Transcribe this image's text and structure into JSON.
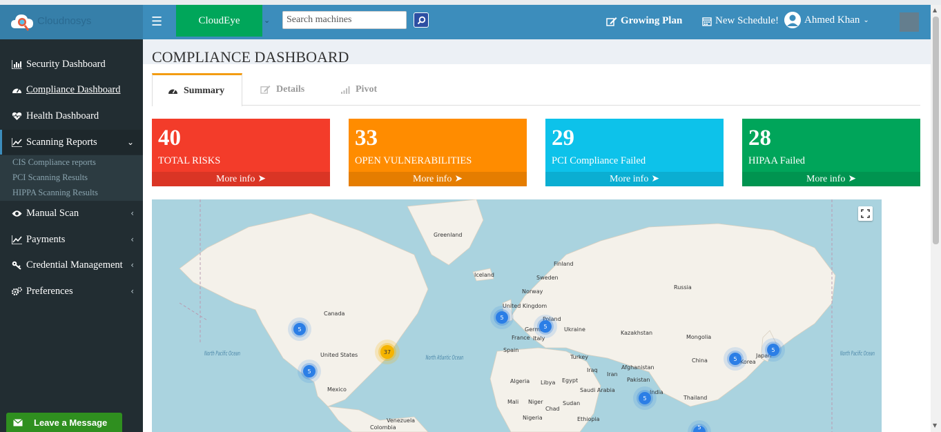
{
  "app": {
    "brand_name": "Cloudnosys"
  },
  "navbar": {
    "project_label": "CloudEye",
    "search_placeholder": "Search machines",
    "plan_label": "Growing Plan",
    "schedule_label": "New Schedule!",
    "user_name": "Ahmed Khan"
  },
  "sidebar": {
    "items": [
      {
        "label": "Security Dashboard",
        "icon": "bar-chart-icon"
      },
      {
        "label": "Compliance Dashboard",
        "icon": "dashboard-icon"
      },
      {
        "label": "Health Dashboard",
        "icon": "heartbeat-icon"
      },
      {
        "label": "Scanning Reports",
        "icon": "line-chart-icon"
      },
      {
        "label": "Manual Scan",
        "icon": "eye-icon"
      },
      {
        "label": "Payments",
        "icon": "line-chart-icon"
      },
      {
        "label": "Credential Management",
        "icon": "key-icon"
      },
      {
        "label": "Preferences",
        "icon": "gears-icon"
      }
    ],
    "sub_items": [
      "CIS Compliance reports",
      "PCI Scanning Results",
      "HIPPA Scanning Results"
    ]
  },
  "page": {
    "title": "COMPLIANCE DASHBOARD"
  },
  "tabs": [
    {
      "label": "Summary",
      "icon": "dashboard-icon"
    },
    {
      "label": "Details",
      "icon": "edit-icon"
    },
    {
      "label": "Pivot",
      "icon": "signal-icon"
    }
  ],
  "stats": [
    {
      "value": "40",
      "label": "TOTAL RISKS",
      "more": "More info",
      "color": "#f33c2a"
    },
    {
      "value": "33",
      "label": "OPEN VULNERABILITIES",
      "more": "More info",
      "color": "#ff8c00"
    },
    {
      "value": "29",
      "label": "PCI Compliance Failed",
      "more": "More info",
      "color": "#0dc2ea"
    },
    {
      "value": "28",
      "label": "HIPAA Failed",
      "more": "More info",
      "color": "#00a55a"
    }
  ],
  "map": {
    "countries": [
      "Greenland",
      "Finland",
      "Iceland",
      "Sweden",
      "Norway",
      "Russia",
      "Canada",
      "United Kingdom",
      "Poland",
      "Germany",
      "Ukraine",
      "France",
      "Kazakhstan",
      "Mongolia",
      "Spain",
      "Italy",
      "Turkey",
      "United States",
      "China",
      "Japan",
      "Korea",
      "Afghanistan",
      "Iraq",
      "Iran",
      "Pakistan",
      "Algeria",
      "Libya",
      "Egypt",
      "Saudi Arabia",
      "India",
      "Mexico",
      "Thailand",
      "Mali",
      "Niger",
      "Chad",
      "Sudan",
      "Nigeria",
      "Ethiopia",
      "Venezuela",
      "Colombia"
    ],
    "oceans": [
      "North Pacific Ocean",
      "North Atlantic Ocean",
      "North Pacific Ocean"
    ],
    "clusters": [
      "5",
      "5",
      "37",
      "5",
      "5",
      "5",
      "5",
      "5",
      "5"
    ]
  },
  "leave_message": "Leave a Message"
}
